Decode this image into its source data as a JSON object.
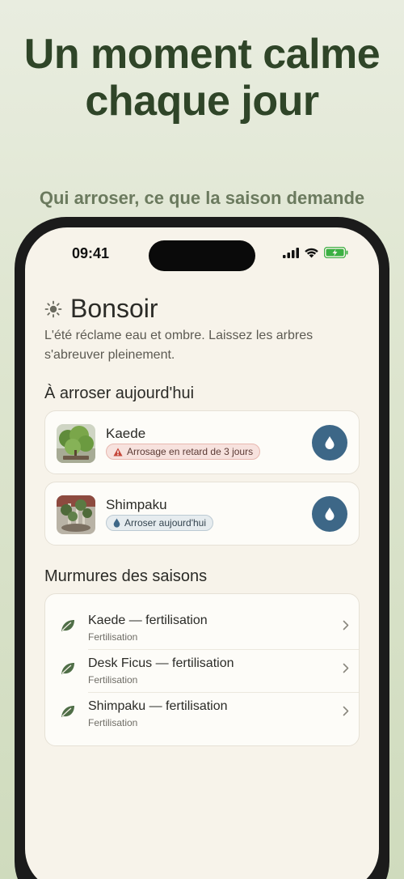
{
  "hero": {
    "title": "Un moment calme chaque jour",
    "subtitle": "Qui arroser, ce que la saison demande"
  },
  "status_bar": {
    "time": "09:41"
  },
  "greeting": {
    "icon": "sun-icon",
    "text": "Bonsoir"
  },
  "tagline": "L'été réclame eau et ombre. Laissez les arbres s'abreuver pleinement.",
  "water_today": {
    "title": "À arroser aujourd'hui",
    "plants": [
      {
        "name": "Kaede",
        "badge": "Arrosage en retard de 3 jours",
        "badge_type": "late",
        "badge_icon": "warning-icon"
      },
      {
        "name": "Shimpaku",
        "badge": "Arroser aujourd'hui",
        "badge_type": "today",
        "badge_icon": "drop-icon"
      }
    ]
  },
  "seasons": {
    "title": "Murmures des saisons",
    "items": [
      {
        "title": "Kaede — fertilisation",
        "subtitle": "Fertilisation",
        "icon": "leaf-icon"
      },
      {
        "title": "Desk Ficus — fertilisation",
        "subtitle": "Fertilisation",
        "icon": "leaf-icon"
      },
      {
        "title": "Shimpaku — fertilisation",
        "subtitle": "Fertilisation",
        "icon": "leaf-icon"
      }
    ]
  },
  "colors": {
    "accent_green": "#2f4528",
    "water_button": "#3d6787",
    "late_badge": "#f7e2de",
    "today_badge": "#e6ecef"
  }
}
